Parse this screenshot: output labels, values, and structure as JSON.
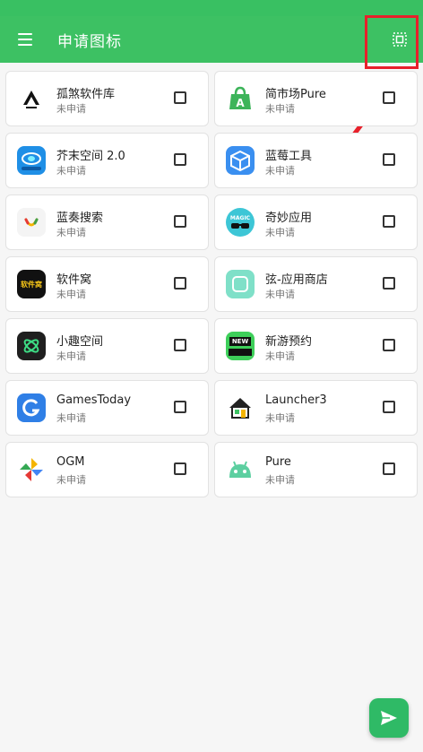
{
  "app_bar": {
    "title": "申请图标",
    "menu_icon": "menu-icon",
    "action_icon": "select-all-icon",
    "bg_color": "#3dc163"
  },
  "annotation": {
    "color": "#e8202b"
  },
  "apps": [
    {
      "name": "孤煞软件库",
      "status": "未申请",
      "icon": "app-icon-gusha",
      "checked": false
    },
    {
      "name": "简市场Pure",
      "status": "未申请",
      "icon": "app-icon-jianshichang",
      "checked": false
    },
    {
      "name": "芥末空间 2.0",
      "status": "未申请",
      "icon": "app-icon-jiemo",
      "checked": false
    },
    {
      "name": "蓝莓工具",
      "status": "未申请",
      "icon": "app-icon-lanmei",
      "checked": false
    },
    {
      "name": "蓝奏搜索",
      "status": "未申请",
      "icon": "app-icon-lanzou",
      "checked": false
    },
    {
      "name": "奇妙应用",
      "status": "未申请",
      "icon": "app-icon-qimiao",
      "checked": false
    },
    {
      "name": "软件窝",
      "status": "未申请",
      "icon": "app-icon-ruanjianwo",
      "checked": false
    },
    {
      "name": "弦-应用商店",
      "status": "未申请",
      "icon": "app-icon-xian",
      "checked": false
    },
    {
      "name": "小趣空间",
      "status": "未申请",
      "icon": "app-icon-xiaoqu",
      "checked": false
    },
    {
      "name": "新游预约",
      "status": "未申请",
      "icon": "app-icon-xinyou",
      "checked": false
    },
    {
      "name": "GamesToday",
      "status": "未申请",
      "icon": "app-icon-gamestoday",
      "checked": false
    },
    {
      "name": "Launcher3",
      "status": "未申请",
      "icon": "app-icon-launcher3",
      "checked": false
    },
    {
      "name": "OGM",
      "status": "未申请",
      "icon": "app-icon-ogm",
      "checked": false
    },
    {
      "name": "Pure",
      "status": "未申请",
      "icon": "app-icon-pure",
      "checked": false
    }
  ],
  "icon_labels": {
    "ruanjianwo": "软件窝",
    "qimiao": "MAGIC",
    "xinyou": "NEW"
  },
  "fab": {
    "icon": "send-icon",
    "color": "#2fba66"
  }
}
